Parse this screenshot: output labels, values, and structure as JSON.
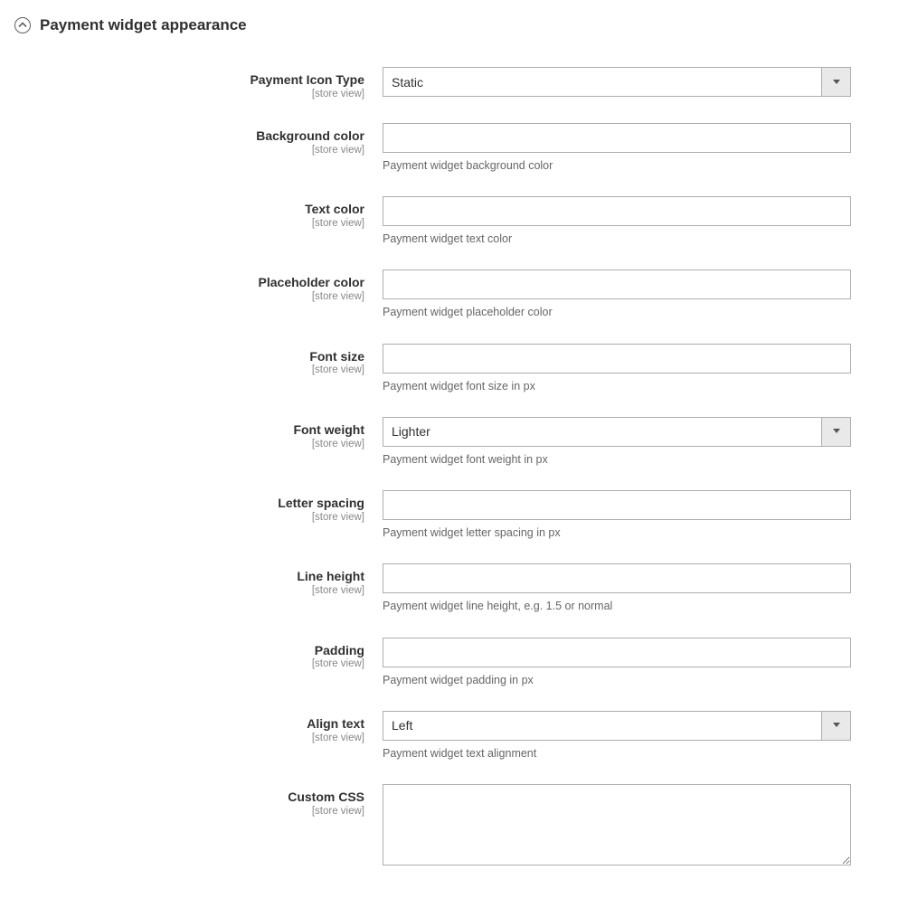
{
  "section": {
    "title": "Payment widget appearance"
  },
  "common": {
    "scope": "[store view]"
  },
  "fields": {
    "icon_type": {
      "label": "Payment Icon Type",
      "value": "Static"
    },
    "bg_color": {
      "label": "Background color",
      "value": "",
      "note": "Payment widget background color"
    },
    "text_color": {
      "label": "Text color",
      "value": "",
      "note": "Payment widget text color"
    },
    "placeholder_color": {
      "label": "Placeholder color",
      "value": "",
      "note": "Payment widget placeholder color"
    },
    "font_size": {
      "label": "Font size",
      "value": "",
      "note": "Payment widget font size in px"
    },
    "font_weight": {
      "label": "Font weight",
      "value": "Lighter",
      "note": "Payment widget font weight in px"
    },
    "letter_spacing": {
      "label": "Letter spacing",
      "value": "",
      "note": "Payment widget letter spacing in px"
    },
    "line_height": {
      "label": "Line height",
      "value": "",
      "note": "Payment widget line height, e.g. 1.5 or normal"
    },
    "padding": {
      "label": "Padding",
      "value": "",
      "note": "Payment widget padding in px"
    },
    "align_text": {
      "label": "Align text",
      "value": "Left",
      "note": "Payment widget text alignment"
    },
    "custom_css": {
      "label": "Custom CSS",
      "value": ""
    }
  }
}
